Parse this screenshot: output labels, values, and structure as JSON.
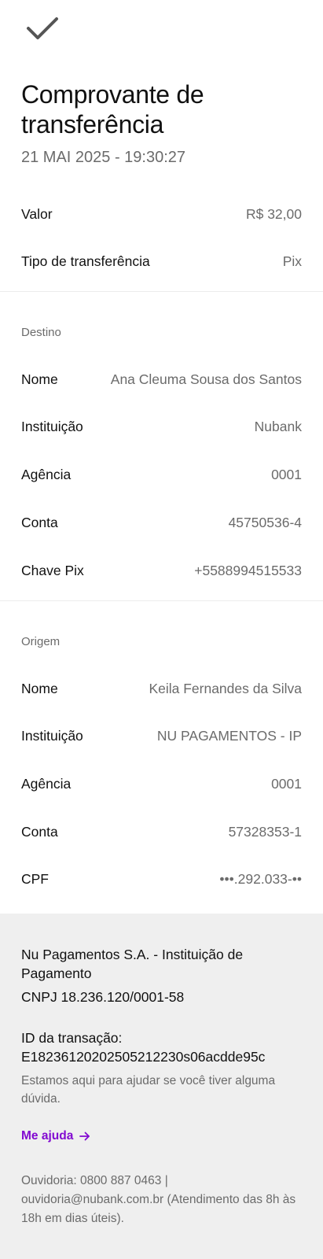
{
  "header": {
    "icon": "check-icon",
    "title": "Comprovante de transferência",
    "date": "21 MAI 2025 - 19:30:27"
  },
  "summary": {
    "valor_label": "Valor",
    "valor_value": "R$ 32,00",
    "tipo_label": "Tipo de transferência",
    "tipo_value": "Pix"
  },
  "destino": {
    "section_label": "Destino",
    "rows": [
      {
        "label": "Nome",
        "value": "Ana Cleuma Sousa dos Santos"
      },
      {
        "label": "Instituição",
        "value": "Nubank"
      },
      {
        "label": "Agência",
        "value": "0001"
      },
      {
        "label": "Conta",
        "value": "45750536-4"
      },
      {
        "label": "Chave Pix",
        "value": "+5588994515533"
      }
    ]
  },
  "origem": {
    "section_label": "Origem",
    "rows": [
      {
        "label": "Nome",
        "value": "Keila Fernandes da Silva"
      },
      {
        "label": "Instituição",
        "value": "NU PAGAMENTOS - IP"
      },
      {
        "label": "Agência",
        "value": "0001"
      },
      {
        "label": "Conta",
        "value": "57328353-1"
      },
      {
        "label": "CPF",
        "value": "•••.292.033-••"
      }
    ]
  },
  "footer": {
    "company": "Nu Pagamentos S.A. - Instituição de Pagamento",
    "cnpj": "CNPJ 18.236.120/0001-58",
    "id_label": "ID da transação:",
    "id_value": "E18236120202505212230s06acdde95c",
    "help_text": "Estamos aqui para ajudar se você tiver alguma dúvida.",
    "link_label": "Me ajuda",
    "link_icon": "arrow-right-icon",
    "ombudsman": "Ouvidoria: 0800 887 0463 | ouvidoria@nubank.com.br (Atendimento das 8h às 18h em dias úteis).",
    "accent_color": "#820ad1"
  }
}
